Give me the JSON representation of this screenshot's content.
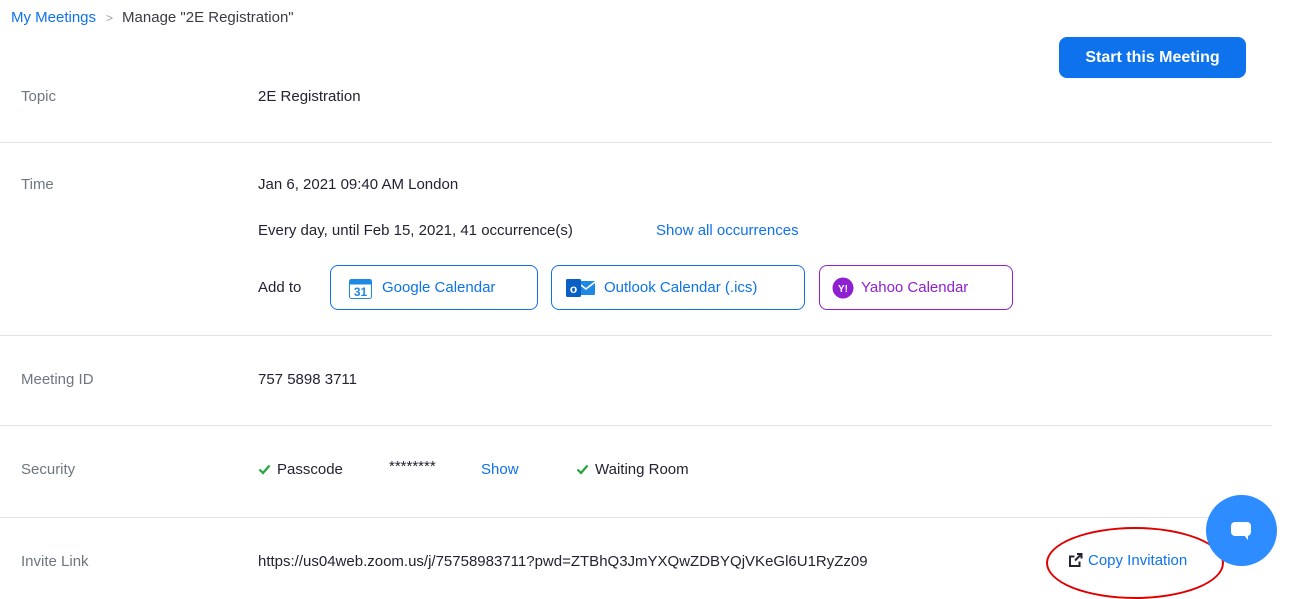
{
  "breadcrumb": {
    "parent": "My Meetings",
    "separator": ">",
    "current": "Manage \"2E Registration\""
  },
  "header": {
    "start_button": "Start this Meeting"
  },
  "topic": {
    "label": "Topic",
    "value": "2E Registration"
  },
  "time": {
    "label": "Time",
    "datetime": "Jan 6, 2021 09:40 AM London",
    "recurrence": "Every day, until Feb 15, 2021, 41 occurrence(s)",
    "show_all": "Show all occurrences",
    "add_to": "Add to",
    "calendars": {
      "google": {
        "label": "Google Calendar",
        "icon": "google-calendar-icon",
        "color": "#0E72ED"
      },
      "outlook": {
        "label": "Outlook Calendar (.ics)",
        "icon": "outlook-icon",
        "color": "#0E72ED"
      },
      "yahoo": {
        "label": "Yahoo Calendar",
        "icon": "yahoo-icon",
        "color": "#8F20D2"
      }
    }
  },
  "meeting_id": {
    "label": "Meeting ID",
    "value": "757 5898 3711"
  },
  "security": {
    "label": "Security",
    "passcode_label": "Passcode",
    "passcode_masked": "********",
    "show": "Show",
    "waiting_room": "Waiting Room"
  },
  "invite": {
    "label": "Invite Link",
    "url": "https://us04web.zoom.us/j/75758983711?pwd=ZTBhQ3JmYXQwZDBYQjVKeGl6U1RyZz09",
    "copy": "Copy Invitation"
  },
  "colors": {
    "accent": "#0E72ED",
    "check": "#23A53B",
    "yahoo": "#8F20D2",
    "annotation": "#E00000",
    "chat": "#2D8CFF"
  }
}
